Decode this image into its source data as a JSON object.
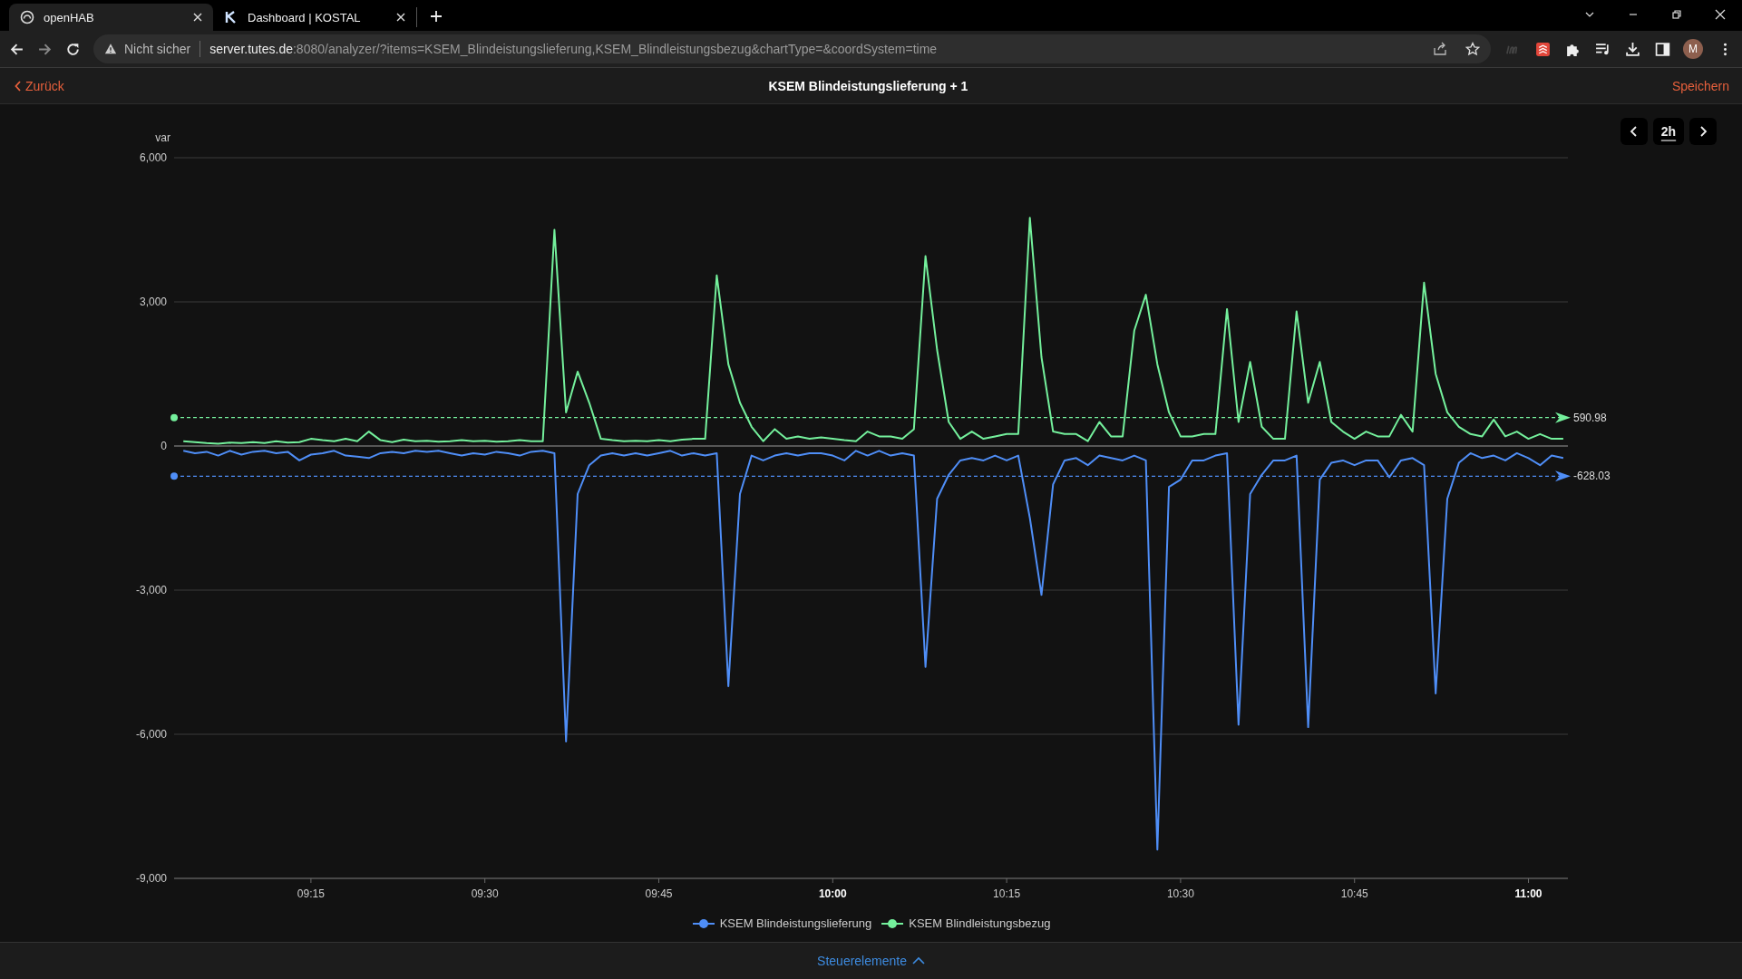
{
  "browser": {
    "tabs": [
      {
        "title": "openHAB",
        "selected": true
      },
      {
        "title": "Dashboard | KOSTAL",
        "selected": false
      }
    ],
    "security_label": "Nicht sicher",
    "url_host": "server.tutes.de",
    "url_rest": ":8080/analyzer/?items=KSEM_Blindeistungslieferung,KSEM_Blindleistungsbezug&chartType=&coordSystem=time",
    "profile_initial": "M"
  },
  "header": {
    "back": "Zurück",
    "title": "KSEM Blindeistungslieferung + 1",
    "save": "Speichern"
  },
  "period": {
    "label": "2h"
  },
  "chart": {
    "chart_data": {
      "type": "line",
      "ylabel": "var",
      "xlim": [
        543.2,
        663.4
      ],
      "ylim": [
        -9000,
        6000
      ],
      "xticks": [
        {
          "value": 555,
          "label": "09:15"
        },
        {
          "value": 570,
          "label": "09:30"
        },
        {
          "value": 585,
          "label": "09:45"
        },
        {
          "value": 600,
          "label": "10:00"
        },
        {
          "value": 615,
          "label": "10:15"
        },
        {
          "value": 630,
          "label": "10:30"
        },
        {
          "value": 645,
          "label": "10:45"
        },
        {
          "value": 660,
          "label": "11:00"
        }
      ],
      "yticks": [
        {
          "value": 6000,
          "label": "6,000"
        },
        {
          "value": 3000,
          "label": "3,000"
        },
        {
          "value": 0,
          "label": "0"
        },
        {
          "value": -3000,
          "label": "-3,000"
        },
        {
          "value": -6000,
          "label": "-6,000"
        },
        {
          "value": -9000,
          "label": "-9,000"
        }
      ],
      "x": [
        544,
        545,
        546,
        547,
        548,
        549,
        550,
        551,
        552,
        553,
        554,
        555,
        556,
        557,
        558,
        559,
        560,
        561,
        562,
        563,
        564,
        565,
        566,
        567,
        568,
        569,
        570,
        571,
        572,
        573,
        574,
        575,
        576,
        577,
        578,
        579,
        580,
        581,
        582,
        583,
        584,
        585,
        586,
        587,
        588,
        589,
        590,
        591,
        592,
        593,
        594,
        595,
        596,
        597,
        598,
        599,
        600,
        601,
        602,
        603,
        604,
        605,
        606,
        607,
        608,
        609,
        610,
        611,
        612,
        613,
        614,
        615,
        616,
        617,
        618,
        619,
        620,
        621,
        622,
        623,
        624,
        625,
        626,
        627,
        628,
        629,
        630,
        631,
        632,
        633,
        634,
        635,
        636,
        637,
        638,
        639,
        640,
        641,
        642,
        643,
        644,
        645,
        646,
        647,
        648,
        649,
        650,
        651,
        652,
        653,
        654,
        655,
        656,
        657,
        658,
        659,
        660,
        661,
        662,
        663
      ],
      "series": [
        {
          "name": "KSEM Blindeistungslieferung",
          "color": "#4f8ef7",
          "values": [
            -100,
            -150,
            -120,
            -200,
            -100,
            -180,
            -120,
            -100,
            -150,
            -120,
            -300,
            -180,
            -150,
            -100,
            -200,
            -220,
            -250,
            -150,
            -120,
            -150,
            -100,
            -120,
            -100,
            -150,
            -200,
            -150,
            -180,
            -120,
            -150,
            -200,
            -120,
            -100,
            -150,
            -6150,
            -1000,
            -400,
            -200,
            -150,
            -200,
            -150,
            -200,
            -150,
            -100,
            -200,
            -150,
            -200,
            -150,
            -5000,
            -1000,
            -200,
            -300,
            -200,
            -150,
            -200,
            -150,
            -150,
            -200,
            -300,
            -100,
            -200,
            -100,
            -200,
            -150,
            -200,
            -4600,
            -1100,
            -600,
            -300,
            -250,
            -300,
            -200,
            -300,
            -200,
            -1500,
            -3100,
            -800,
            -300,
            -250,
            -400,
            -200,
            -250,
            -300,
            -200,
            -300,
            -8400,
            -850,
            -700,
            -300,
            -300,
            -200,
            -150,
            -5800,
            -1000,
            -600,
            -300,
            -300,
            -200,
            -5850,
            -700,
            -350,
            -300,
            -400,
            -300,
            -300,
            -650,
            -300,
            -250,
            -400,
            -5150,
            -1100,
            -350,
            -150,
            -250,
            -200,
            -300,
            -150,
            -250,
            -400,
            -200,
            -250
          ]
        },
        {
          "name": "KSEM Blindleistungsbezug",
          "color": "#74f09c",
          "values": [
            100,
            80,
            60,
            50,
            70,
            60,
            80,
            60,
            100,
            70,
            80,
            150,
            120,
            100,
            150,
            100,
            300,
            120,
            80,
            130,
            100,
            110,
            90,
            100,
            120,
            100,
            110,
            90,
            100,
            120,
            100,
            100,
            4500,
            700,
            1550,
            900,
            150,
            120,
            100,
            110,
            100,
            120,
            100,
            130,
            150,
            150,
            3550,
            1700,
            900,
            400,
            100,
            350,
            150,
            200,
            150,
            180,
            150,
            120,
            100,
            300,
            200,
            200,
            150,
            350,
            3950,
            2000,
            500,
            150,
            300,
            150,
            200,
            250,
            250,
            4750,
            1850,
            300,
            250,
            250,
            100,
            500,
            200,
            200,
            2400,
            3150,
            1700,
            700,
            200,
            200,
            250,
            250,
            2850,
            500,
            1750,
            400,
            150,
            150,
            2800,
            900,
            1750,
            500,
            300,
            150,
            300,
            200,
            200,
            650,
            300,
            3400,
            1500,
            700,
            400,
            250,
            200,
            550,
            200,
            300,
            150,
            250,
            150,
            150
          ]
        }
      ],
      "grid": true,
      "ref_lines": [
        {
          "axis": "y",
          "value": 590.98,
          "label": "590.98",
          "color": "#74f09c"
        },
        {
          "axis": "y",
          "value": -628.03,
          "label": "-628.03",
          "color": "#4f8ef7"
        }
      ]
    }
  },
  "footer": {
    "label": "Steuerelemente"
  }
}
